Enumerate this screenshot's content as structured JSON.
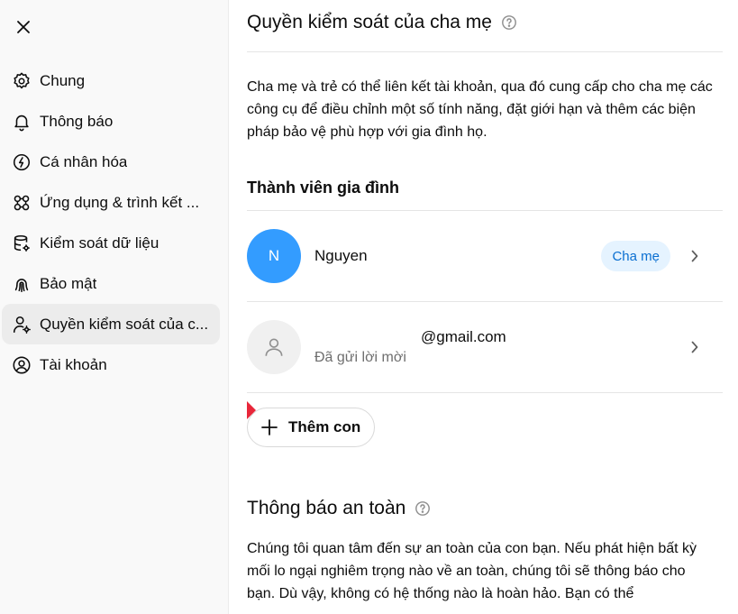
{
  "sidebar": {
    "items": [
      {
        "label": "Chung",
        "icon": "gear-icon",
        "active": false
      },
      {
        "label": "Thông báo",
        "icon": "bell-icon",
        "active": false
      },
      {
        "label": "Cá nhân hóa",
        "icon": "personalize-icon",
        "active": false
      },
      {
        "label": "Ứng dụng & trình kết ...",
        "icon": "apps-icon",
        "active": false
      },
      {
        "label": "Kiểm soát dữ liệu",
        "icon": "database-icon",
        "active": false
      },
      {
        "label": "Bảo mật",
        "icon": "fingerprint-icon",
        "active": false
      },
      {
        "label": "Quyền kiểm soát của c...",
        "icon": "parent-icon",
        "active": true
      },
      {
        "label": "Tài khoản",
        "icon": "account-icon",
        "active": false
      }
    ]
  },
  "main": {
    "title": "Quyền kiểm soát của cha mẹ",
    "description": "Cha mẹ và trẻ có thể liên kết tài khoản, qua đó cung cấp cho cha mẹ các công cụ để điều chỉnh một số tính năng, đặt giới hạn và thêm các biện pháp bảo vệ phù hợp với gia đình họ.",
    "family_title": "Thành viên gia đình",
    "members": [
      {
        "initial": "N",
        "name": "Nguyen",
        "badge": "Cha mẹ"
      },
      {
        "email": "@gmail.com",
        "status": "Đã gửi lời mời"
      }
    ],
    "add_child_label": "Thêm con",
    "safety_title": "Thông báo an toàn",
    "safety_description": "Chúng tôi quan tâm đến sự an toàn của con bạn. Nếu phát hiện bất kỳ mối lo ngại nghiêm trọng nào về an toàn, chúng tôi sẽ thông báo cho bạn. Dù vậy, không có hệ thống nào là hoàn hảo. Bạn có thể"
  },
  "colors": {
    "accent": "#339cff",
    "badge_bg": "#e5f3ff",
    "badge_text": "#0a6fd1",
    "sidebar_bg": "#f9f9f9",
    "active_bg": "#ececec"
  }
}
